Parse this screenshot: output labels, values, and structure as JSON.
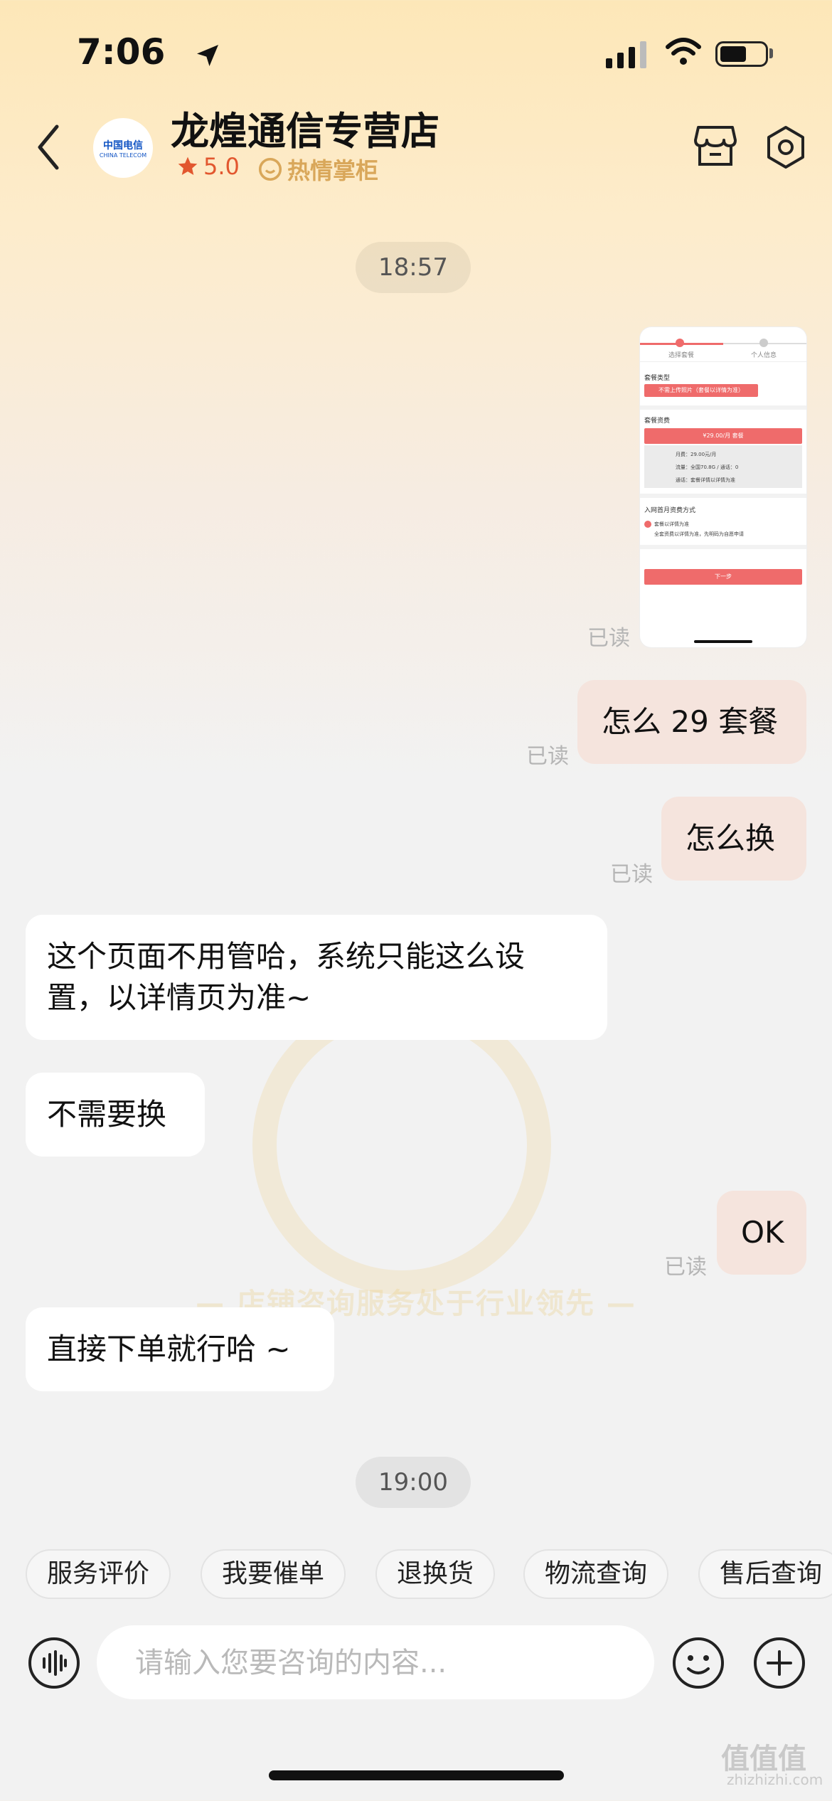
{
  "status_bar": {
    "time": "7:06"
  },
  "header": {
    "shop_name": "龙煌通信专营店",
    "rating": "5.0",
    "tag": "热情掌柜",
    "avatar_brand": "中国电信",
    "avatar_brand_en": "CHINA TELECOM"
  },
  "watermark": {
    "text": "— 店铺咨询服务处于行业领先 —"
  },
  "timestamps": [
    "18:57",
    "19:00"
  ],
  "shared_image": {
    "step1": "选择套餐",
    "step2": "个人信息",
    "section1": "套餐类型",
    "option1": "不需上传照片（套餐以详情为准）",
    "section2": "套餐资费",
    "price_btn": "¥29.00/月 套餐",
    "detail1": "月费：29.00元/月",
    "detail2": "流量：全国70.8G / 通话：0",
    "detail3": "通话：套餐详情以详情为准",
    "section3": "入网首月资费方式",
    "radio_text": "套餐以详情为准",
    "radio_sub": "全套资费以详情为准，先明码为自愿申请",
    "next_btn": "下一步"
  },
  "messages": {
    "read_label": "已读",
    "m1": "怎么 29 套餐",
    "m2": "怎么换",
    "m3_line1": "这个页面不用管哈，系统只能这么设",
    "m3_line2": "置，以详情页为准~",
    "m4": "不需要换",
    "m5": "OK",
    "m6": "直接下单就行哈 ~"
  },
  "quick_actions": [
    "服务评价",
    "我要催单",
    "退换货",
    "物流查询",
    "售后查询"
  ],
  "input": {
    "placeholder": "请输入您要咨询的内容..."
  },
  "site_watermark": {
    "glyphs": "值值值",
    "domain": "zhizhizhi.com"
  },
  "colors": {
    "accent": "#e2572f",
    "bubble_self": "#f5e4dd",
    "tag_gold": "#d9a75a"
  },
  "icons": [
    "location-arrow-icon",
    "signal-icon",
    "wifi-icon",
    "battery-icon",
    "back-chevron-icon",
    "star-icon",
    "smile-badge-icon",
    "store-icon",
    "settings-icon",
    "voice-icon",
    "emoji-icon",
    "plus-icon"
  ]
}
